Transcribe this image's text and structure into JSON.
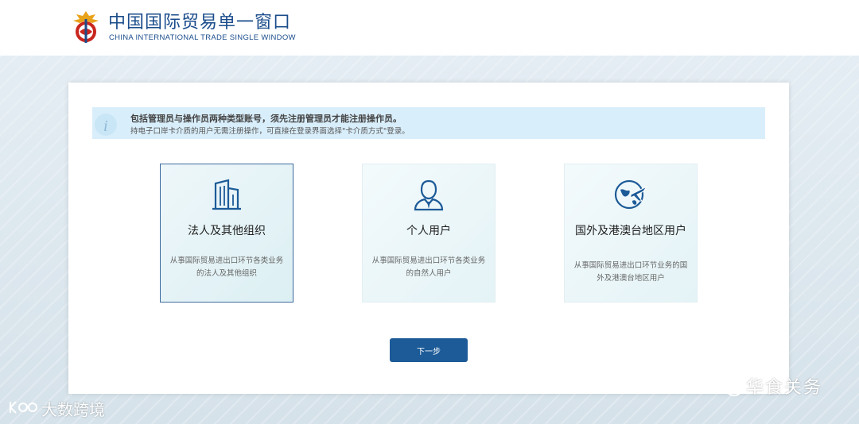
{
  "header": {
    "logo_cn": "中国国际贸易单一窗口",
    "logo_en": "CHINA INTERNATIONAL TRADE SINGLE WINDOW"
  },
  "notice": {
    "bold": "包括管理员与操作员两种类型账号，须先注册管理员才能注册操作员。",
    "sub": "持电子口岸卡介质的用户无需注册操作，可直接在登录界面选择\"卡介质方式\"登录。"
  },
  "cards": [
    {
      "title": "法人及其他组织",
      "desc": "从事国际贸易进出口环节各类业务的法人及其他组织",
      "icon": "building-icon",
      "selected": true
    },
    {
      "title": "个人用户",
      "desc": "从事国际贸易进出口环节各类业务的自然人用户",
      "icon": "person-icon",
      "selected": false
    },
    {
      "title": "国外及港澳台地区用户",
      "desc": "从事国际贸易进出口环节业务的国外及港澳台地区用户",
      "icon": "globe-plane-icon",
      "selected": false
    }
  ],
  "next_button": "下一步",
  "watermarks": {
    "left": "大数跨境",
    "right": "华食关务"
  },
  "colors": {
    "primary": "#1d5b98",
    "brand": "#1a4c8b",
    "notice_bg": "#d9eefb"
  }
}
